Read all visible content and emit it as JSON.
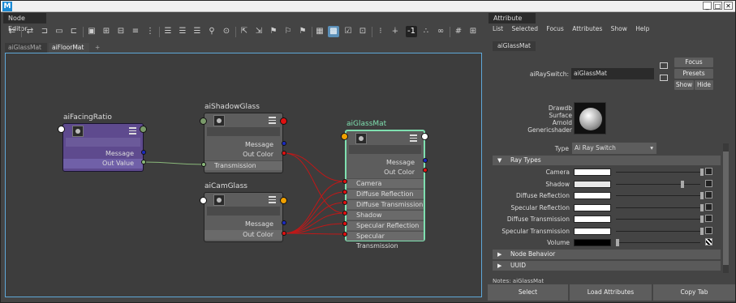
{
  "window": {
    "min": "_",
    "max": "□",
    "close": "✕"
  },
  "node_editor": {
    "panel_title": "Node Editor",
    "tabs": [
      "aiGlassMat",
      "aiFloorMat",
      "+"
    ],
    "active_tab": 1,
    "nodes": {
      "facing": {
        "name": "aiFacingRatio",
        "ports": [
          "Message",
          "Out Value"
        ]
      },
      "shadow": {
        "name": "aiShadowGlass",
        "outs": [
          "Message",
          "Out Color"
        ],
        "ins": [
          "Transmission"
        ]
      },
      "cam": {
        "name": "aiCamGlass",
        "outs": [
          "Message",
          "Out Color"
        ]
      },
      "glass": {
        "name": "aiGlassMat",
        "outs": [
          "Message",
          "Out Color"
        ],
        "ins": [
          "Camera",
          "Diffuse Reflection",
          "Diffuse Transmission",
          "Shadow",
          "Specular Reflection",
          "Specular Transmission"
        ]
      }
    }
  },
  "attribute_editor": {
    "panel_title": "Attribute Editor",
    "menu": [
      "List",
      "Selected",
      "Focus",
      "Attributes",
      "Show",
      "Help"
    ],
    "tab": "aiGlassMat",
    "switch_label": "aiRaySwitch:",
    "switch_value": "aiGlassMat",
    "focus": "Focus",
    "presets": "Presets",
    "show": "Show",
    "hide": "Hide",
    "shader_desc": [
      "Drawdb",
      "Surface",
      "Arnold",
      "Genericshader"
    ],
    "type_label": "Type",
    "type_value": "Ai Ray Switch",
    "sections": [
      "Ray Types",
      "Node Behavior",
      "UUID",
      "Notes: aiGlassMat"
    ],
    "ray_rows": [
      "Camera",
      "Shadow",
      "Diffuse Reflection",
      "Specular Reflection",
      "Diffuse Transmission",
      "Specular Transmission",
      "Volume"
    ],
    "bottom": [
      "Select",
      "Load Attributes",
      "Copy Tab"
    ]
  },
  "colors": {
    "accent": "#5fa8d8",
    "purple_node": "#5e4a8e",
    "selected_border": "#7fe0b0",
    "wire_red": "#c01818",
    "wire_green": "#8ab87a"
  }
}
